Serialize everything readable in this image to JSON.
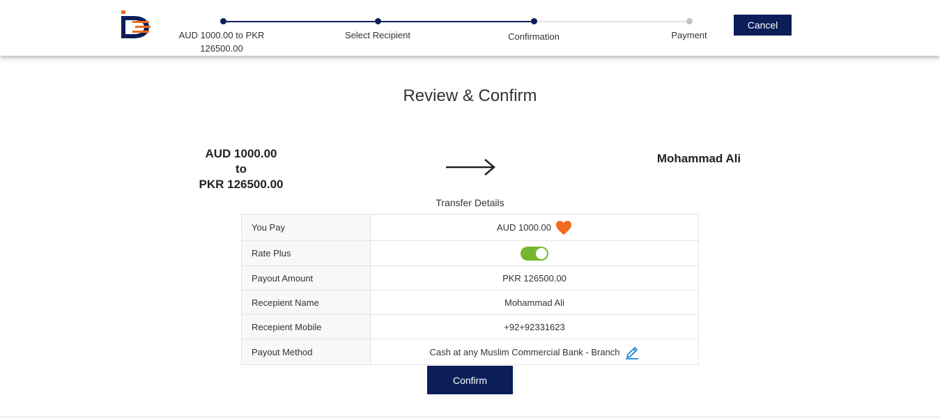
{
  "colors": {
    "primary": "#0b1e57",
    "accent": "#f26b1d",
    "toggle_on": "#74b72e",
    "edit_icon": "#1a87d9"
  },
  "stepper": {
    "steps": [
      {
        "label_line1": "AUD 1000.00 to PKR",
        "label_line2": "126500.00",
        "status": "done"
      },
      {
        "label": "Select Recipient",
        "status": "done"
      },
      {
        "label": "Confirmation",
        "status": "current"
      },
      {
        "label": "Payment",
        "status": "todo"
      }
    ]
  },
  "header": {
    "cancel_label": "Cancel",
    "logo_icon": "logo-icon"
  },
  "page": {
    "title": "Review & Confirm"
  },
  "summary": {
    "send_amount": "AUD 1000.00",
    "connector": "to",
    "receive_amount": "PKR 126500.00",
    "arrow_icon": "arrow-right-icon",
    "recipient": "Mohammad Ali"
  },
  "details": {
    "title": "Transfer Details",
    "rows": {
      "you_pay": {
        "label": "You Pay",
        "value": "AUD 1000.00",
        "icon": "heart-icon"
      },
      "rate_plus": {
        "label": "Rate Plus",
        "toggle_on": true
      },
      "payout_amount": {
        "label": "Payout Amount",
        "value": "PKR 126500.00"
      },
      "recipient_name": {
        "label": "Recepient Name",
        "value": "Mohammad Ali"
      },
      "recipient_mobile": {
        "label": "Recepient Mobile",
        "value": "+92+92331623"
      },
      "payout_method": {
        "label": "Payout Method",
        "value": "Cash at any Muslim Commercial Bank - Branch",
        "icon": "edit-pencil-icon"
      }
    }
  },
  "actions": {
    "confirm_label": "Confirm"
  }
}
